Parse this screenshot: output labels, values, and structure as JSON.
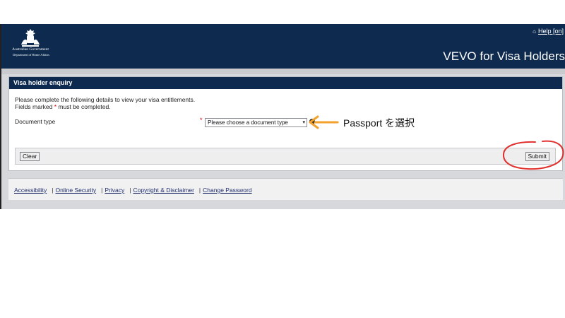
{
  "header": {
    "gov_name": "Australian Government",
    "dept_name": "Department of Home Affairs",
    "help_link": "Help [on]",
    "app_title": "VEVO for Visa Holders"
  },
  "panel": {
    "title": "Visa holder enquiry",
    "intro_line1": "Please complete the following details to view your visa entitlements.",
    "intro_line2_a": "Fields marked ",
    "intro_line2_star": "*",
    "intro_line2_b": " must be completed.",
    "doc_label": "Document type",
    "required_mark": "*",
    "doc_select_value": "Please choose a document type",
    "clear_label": "Clear",
    "submit_label": "Submit"
  },
  "footer": {
    "links": [
      "Accessibility",
      "Online Security",
      "Privacy",
      "Copyright & Disclaimer",
      "Change Password"
    ],
    "separator": "|"
  },
  "annotation": {
    "text": "Passport を選択",
    "arrow_color": "#f2a12c",
    "circle_color": "#e0312f"
  },
  "colors": {
    "header_bg": "#0e2b4f",
    "required": "#cc0000",
    "link": "#1f2d6b"
  },
  "icons": {
    "crest": "coat-of-arms-icon",
    "help": "house-icon",
    "select": "chevron-down-icon",
    "info": "info-icon"
  }
}
